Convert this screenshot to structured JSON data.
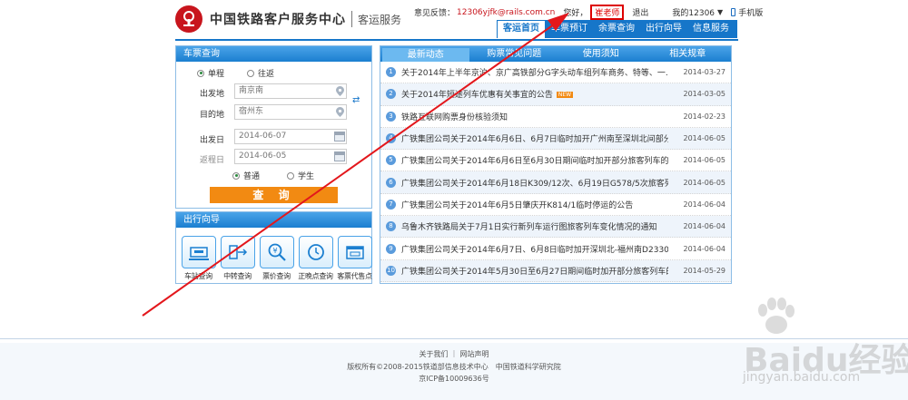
{
  "header": {
    "title": "中国铁路客户服务中心",
    "subtitle": "客运服务",
    "feedback_label": "意见反馈：",
    "feedback_email": "12306yjfk@rails.com.cn",
    "greeting": "您好，",
    "username": "崔老师",
    "logout": "退出",
    "my12306": "我的12306",
    "mobile": "手机版"
  },
  "nav": {
    "items": [
      "客运首页",
      "车票预订",
      "余票查询",
      "出行向导",
      "信息服务"
    ]
  },
  "ticket": {
    "title": "车票查询",
    "oneway": "单程",
    "roundtrip": "往返",
    "from_label": "出发地",
    "from_value": "南京南",
    "to_label": "目的地",
    "to_value": "宿州东",
    "depart_label": "出发日",
    "depart_value": "2014-06-07",
    "return_label": "返程日",
    "return_value": "2014-06-05",
    "normal": "普通",
    "student": "学生",
    "query": "查 询"
  },
  "guide": {
    "title": "出行向导",
    "items": [
      "车站查询",
      "中转查询",
      "票价查询",
      "正晚点查询",
      "客票代售点"
    ]
  },
  "news": {
    "tabs": [
      "最新动态",
      "购票常见问题",
      "使用须知",
      "相关规章"
    ],
    "badge": "NEW",
    "items": [
      {
        "n": "1",
        "title": "关于2014年上半年京沪、京广高铁部分G字头动车组列车商务、特等、一...",
        "date": "2014-03-27"
      },
      {
        "n": "2",
        "title": "关于2014年短途列车优惠有关事宜的公告",
        "date": "2014-03-05"
      },
      {
        "n": "3",
        "title": "铁路互联网购票身份核验须知",
        "date": "2014-02-23"
      },
      {
        "n": "4",
        "title": "广铁集团公司关于2014年6月6日、6月7日临时加开广州南至深圳北间部分...",
        "date": "2014-06-05"
      },
      {
        "n": "5",
        "title": "广铁集团公司关于2014年6月6日至6月30日期间临时加开部分旅客列车的...",
        "date": "2014-06-05"
      },
      {
        "n": "6",
        "title": "广铁集团公司关于2014年6月18日K309/12次、6月19日G578/5次旅客列车...",
        "date": "2014-06-05"
      },
      {
        "n": "7",
        "title": "广铁集团公司关于2014年6月5日肇庆开K814/1临时停运的公告",
        "date": "2014-06-04"
      },
      {
        "n": "8",
        "title": "乌鲁木齐铁路局关于7月1日实行新列车运行图旅客列车变化情况的通知",
        "date": "2014-06-04"
      },
      {
        "n": "9",
        "title": "广铁集团公司关于2014年6月7日、6月8日临时加开深圳北-福州南D2330...",
        "date": "2014-06-04"
      },
      {
        "n": "10",
        "title": "广铁集团公司关于2014年5月30日至6月27日期间临时加开部分旅客列车的...",
        "date": "2014-05-29"
      }
    ]
  },
  "footer": {
    "links": "关于我们 ｜ 网站声明",
    "copyright": "版权所有©2008-2015铁道部信息技术中心　中国铁道科学研究院",
    "icp": "京ICP备10009636号"
  },
  "watermark": {
    "brand": "Baidu经验",
    "url": "jingyan.baidu.com"
  },
  "colors": {
    "brand_red": "#c8151d",
    "nav_blue": "#1676c9",
    "button_orange": "#f28a12"
  }
}
